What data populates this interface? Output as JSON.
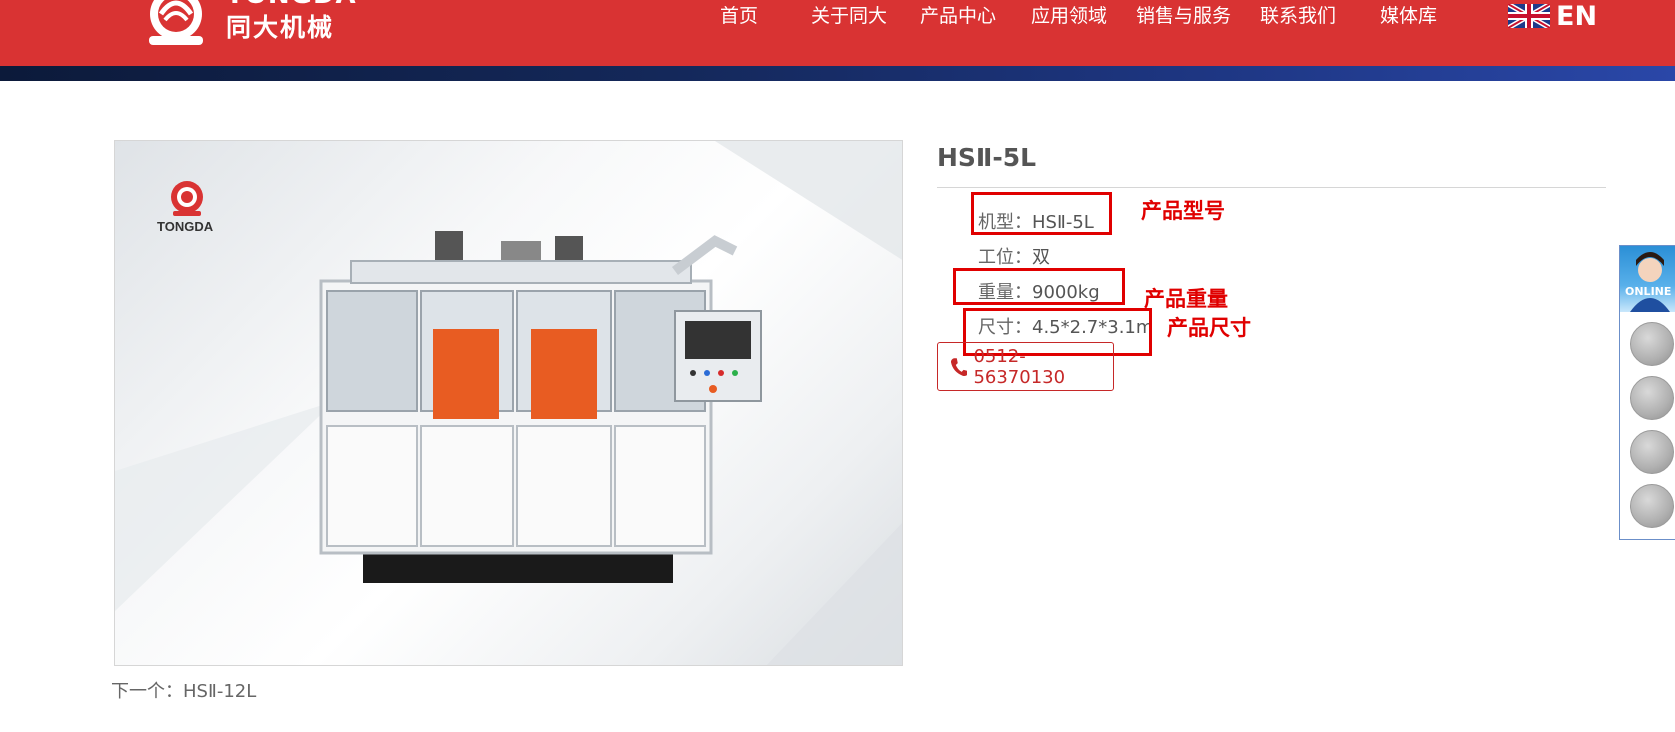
{
  "header": {
    "logo_en": "TONGDA",
    "logo_cn": "同大机械",
    "nav": [
      "首页",
      "关于同大",
      "产品中心",
      "应用领域",
      "销售与服务",
      "联系我们",
      "媒体库"
    ],
    "lang_label": "EN"
  },
  "product": {
    "image_brand": "TONGDA",
    "title": "HSⅡ-5L",
    "specs": [
      {
        "label": "机型：",
        "value": "HSⅡ-5L"
      },
      {
        "label": "工位：",
        "value": "双"
      },
      {
        "label": "重量：",
        "value": "9000kg"
      },
      {
        "label": "尺寸：",
        "value": "4.5*2.7*3.1m"
      }
    ],
    "phone": "0512-56370130"
  },
  "annotations": {
    "model": "产品型号",
    "weight": "产品重量",
    "size": "产品尺寸"
  },
  "pager": {
    "next_label": "下一个：",
    "next_value": "HSⅡ-12L"
  },
  "sidebar": {
    "online_text": "ONLINE"
  },
  "colors": {
    "header_red": "#d93333",
    "annotation_red": "#e00000",
    "phone_red": "#c62828"
  },
  "icons": [
    "phone-icon",
    "uk-flag-icon",
    "online-service-icon"
  ]
}
